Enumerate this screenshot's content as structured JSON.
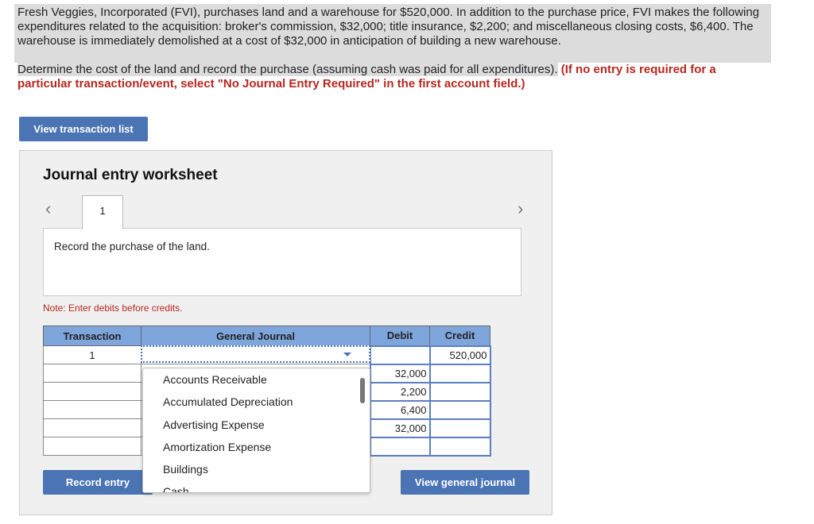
{
  "question": {
    "text": "Fresh Veggies, Incorporated (FVI), purchases land and a warehouse for $520,000. In addition to the purchase price, FVI makes the following expenditures related to the acquisition: broker's commission, $32,000; title insurance, $2,200; and miscellaneous closing costs, $6,400. The warehouse is immediately demolished at a cost of $32,000 in anticipation of building a new warehouse.",
    "instruction": "Determine the cost of the land and record the purchase (assuming cash was paid for all expenditures).",
    "note": "(If no entry is required for a particular transaction/event, select \"No Journal Entry Required\" in the first account field.)"
  },
  "view_transaction_list": "View transaction list",
  "worksheet": {
    "title": "Journal entry worksheet",
    "tab": "1",
    "description": "Record the purchase of the land.",
    "note": "Note: Enter debits before credits.",
    "headers": [
      "Transaction",
      "General Journal",
      "Debit",
      "Credit"
    ],
    "rows": [
      {
        "t": "1",
        "debit": "",
        "credit": "520,000"
      },
      {
        "t": "",
        "debit": "32,000",
        "credit": ""
      },
      {
        "t": "",
        "debit": "2,200",
        "credit": ""
      },
      {
        "t": "",
        "debit": "6,400",
        "credit": ""
      },
      {
        "t": "",
        "debit": "32,000",
        "credit": ""
      },
      {
        "t": "",
        "debit": "",
        "credit": ""
      }
    ],
    "dropdown_options": [
      "Accounts Receivable",
      "Accumulated Depreciation",
      "Advertising Expense",
      "Amortization Expense",
      "Buildings",
      "Cash"
    ],
    "record_entry": "Record entry",
    "view_general_journal": "View general journal"
  }
}
